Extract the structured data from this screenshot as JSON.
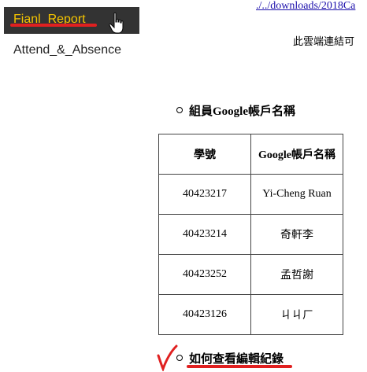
{
  "nav": {
    "active_label": "Fianl_Report",
    "item_label": "Attend_&_Absence"
  },
  "top_link": "./../downloads/2018Ca",
  "note": "此雲端連結可",
  "section1": {
    "heading": "組員Google帳戶名稱"
  },
  "table": {
    "headers": [
      "學號",
      "Google帳戶名稱"
    ],
    "rows": [
      [
        "40423217",
        "Yi-Cheng Ruan"
      ],
      [
        "40423214",
        "奇軒李"
      ],
      [
        "40423252",
        "孟哲謝"
      ],
      [
        "40423126",
        "ㄐㄐㄏ"
      ]
    ]
  },
  "section2": {
    "heading": "如何查看編輯紀錄"
  },
  "colors": {
    "nav_bg": "#333333",
    "nav_active_text": "#f5c400",
    "annotation_red": "#e02020",
    "link": "#1a0dab"
  },
  "icons": [
    "hand-pointer-icon",
    "checkmark-annotation-icon"
  ]
}
